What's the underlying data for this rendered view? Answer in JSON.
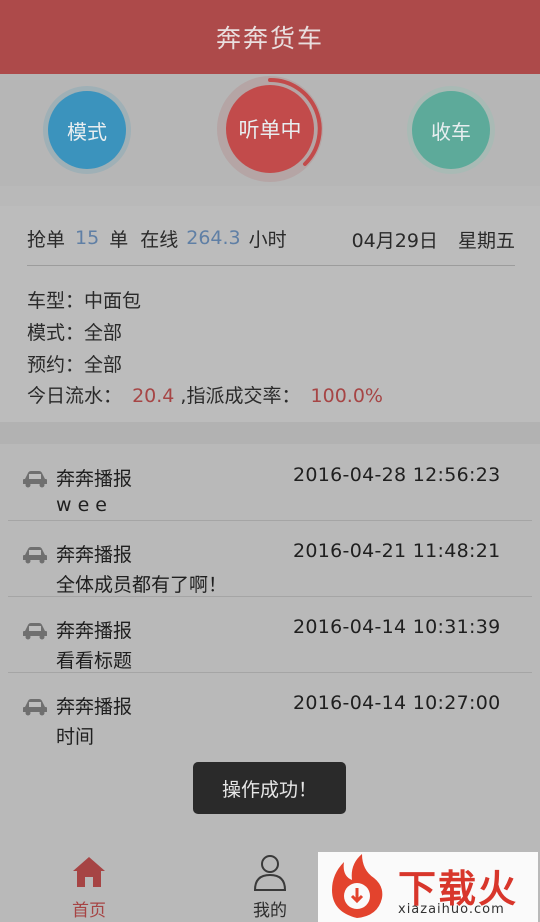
{
  "header": {
    "title": "奔奔货车"
  },
  "modes": {
    "mode_label": "模式",
    "listening_label": "听单中",
    "collect_label": "收车"
  },
  "stats": {
    "grab_prefix": "抢单",
    "grab_count": "15",
    "grab_unit": "单",
    "online_prefix": "在线",
    "online_hours": "264.3",
    "online_unit": "小时",
    "date": "04月29日",
    "weekday": "星期五"
  },
  "info": {
    "vehicle_type": "车型：中面包",
    "mode": "模式：全部",
    "booking": "预约：全部",
    "revenue_prefix": "今日流水：",
    "revenue_value": "20.4",
    "dispatch_prefix": ",指派成交率：",
    "dispatch_rate": "100.0%"
  },
  "news": [
    {
      "source": "奔奔播报",
      "time": "2016-04-28 12:56:23",
      "message": "w e e"
    },
    {
      "source": "奔奔播报",
      "time": "2016-04-21 11:48:21",
      "message": "全体成员都有了啊！"
    },
    {
      "source": "奔奔播报",
      "time": "2016-04-14 10:31:39",
      "message": "看看标题"
    },
    {
      "source": "奔奔播报",
      "time": "2016-04-14 10:27:00",
      "message": "时间"
    }
  ],
  "toast": {
    "text": "操作成功！"
  },
  "tabs": {
    "home": "首页",
    "mine": "我的"
  },
  "watermark": {
    "brand": "下载火",
    "url": "xiazaihuo.com"
  }
}
